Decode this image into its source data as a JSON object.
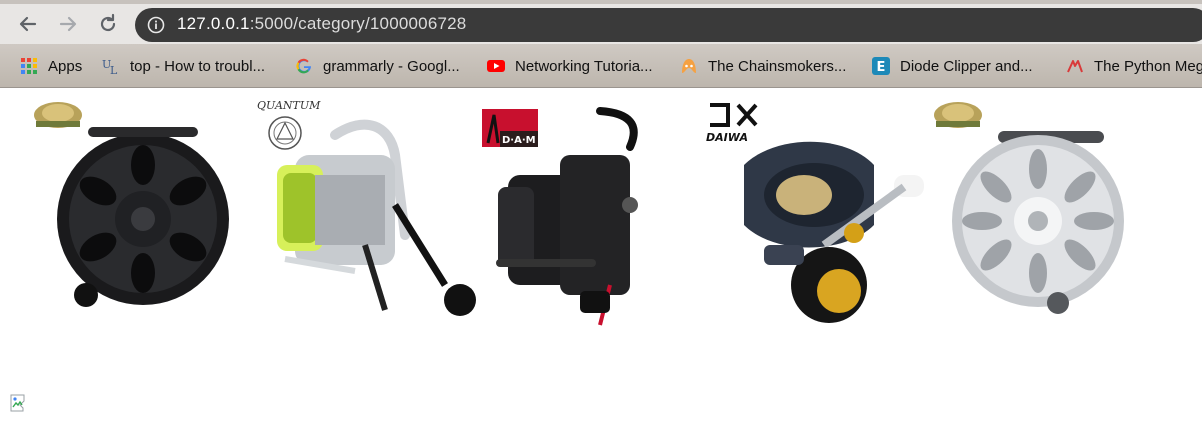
{
  "browser": {
    "url_host": "127.0.0.1",
    "url_rest": ":5000/category/1000006728"
  },
  "bookmarks": [
    {
      "label": "Apps",
      "icon": "apps-grid-icon"
    },
    {
      "label": "top - How to troubl...",
      "icon": "unix-linux-icon"
    },
    {
      "label": "grammarly - Googl...",
      "icon": "google-icon"
    },
    {
      "label": "Networking Tutoria...",
      "icon": "youtube-icon"
    },
    {
      "label": "The Chainsmokers...",
      "icon": "chainsmokers-icon"
    },
    {
      "label": "Diode Clipper and...",
      "icon": "e-icon"
    },
    {
      "label": "The Python Meg",
      "icon": "python-mega-icon"
    }
  ],
  "products": [
    {
      "name": "black-fly-reel",
      "brand_logo": "owl-brand-logo"
    },
    {
      "name": "quantum-spinning-reel",
      "brand_logo": "QUANTUM"
    },
    {
      "name": "dam-spinning-reel",
      "brand_logo": "D·A·M"
    },
    {
      "name": "daiwa-baitcast-reel",
      "brand_logo": "DAIWA"
    },
    {
      "name": "silver-fly-reel",
      "brand_logo": "owl-brand-logo"
    }
  ],
  "colors": {
    "tab_bar": "#e8e6e4",
    "omnibox": "#3a3a3a",
    "bookmark_bar": "#c6c0b9",
    "page_background": "#ffffff"
  }
}
